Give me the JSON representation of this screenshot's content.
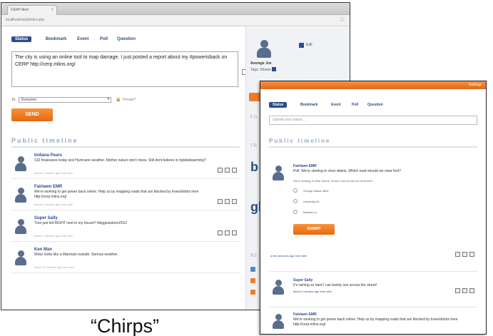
{
  "back_window": {
    "browser": {
      "tab_title": "CERP Alert",
      "tab_close": "×",
      "url": "localhost/cerp/index.php",
      "star": "☆"
    },
    "tabs": [
      "Status",
      "Bookmark",
      "Event",
      "Poll",
      "Question"
    ],
    "composer": {
      "text": "The city is using an online tool to map damage. I just posted a report about my #powerisback on CERP http://cerp.mlins.org/"
    },
    "audience": {
      "to_label": "To:",
      "selected": "Everyone",
      "private_label": "Private?"
    },
    "send_label": "SEND",
    "timeline_title": "Public timeline",
    "chirps": [
      {
        "name": "Indiana Pears",
        "text": "132 freakwave today and Hurricane weather. Mother nature don't mess. Still dont believe in #globalwarming?",
        "meta": "about 2 minutes ago from web"
      },
      {
        "name": "Fairlawn EMR",
        "text": "We're working to get power back online. Help us by mapping roads that are blocked by trees/debris here http://cerp.mlins.org/",
        "meta": "about 5 minutes ago from web"
      },
      {
        "name": "Super Sally",
        "text": "Tree just fell RIGHT next to my house!! #biggeststorm2012",
        "meta": "about 7 minutes ago from web"
      },
      {
        "name": "Ken Man",
        "text": "Wow! looks like a Warmain outside. Serious weather.",
        "meta": "about 11 minutes ago from web"
      }
    ],
    "sidebar": {
      "checkbox_label": "Edit",
      "user_name": "Average Joe",
      "tags_label": "Tags: Shows",
      "follow_heading": "FO",
      "trending_heading": "TR",
      "big_letter_1": "b",
      "big_letter_2": "gl",
      "resources_heading": "RE"
    }
  },
  "front_window": {
    "settings_label": "Settings",
    "tabs": [
      "Status",
      "Bookmark",
      "Event",
      "Poll",
      "Question"
    ],
    "input_placeholder": "Update your status...",
    "timeline_title": "Public timeline",
    "poll": {
      "name": "Fairlawn EMR",
      "text": "Poll: We're starting to clear debris. Which road should we clear first?",
      "question": "We're starting to clear debris. Which road should we clear first?",
      "options": [
        "George Mason Blvd",
        "University Dr",
        "Braxton Ln"
      ],
      "submit_label": "SUBMIT",
      "meta": "a few seconds ago from web"
    },
    "posts": [
      {
        "name": "Super Sally",
        "text": "It's raining so hard I can barely see across the street!",
        "meta": "about 3 minutes ago from web"
      },
      {
        "name": "Fairlawn EMR",
        "text": "We're working to get power back online. Help us by mapping roads that are blocked by trees/debris here http://cerp.mlins.org/"
      }
    ]
  },
  "caption": "“Chirps”",
  "colors": {
    "accent_orange": "#f07c28",
    "brand_blue": "#2c4c8a",
    "avatar_gray": "#5a6d8c"
  }
}
